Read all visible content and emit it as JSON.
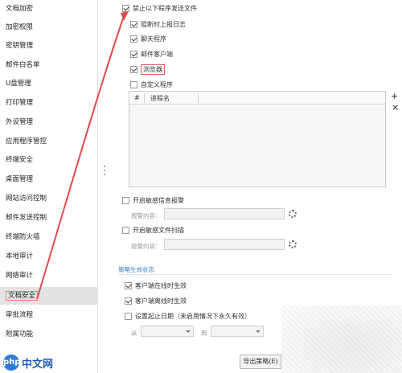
{
  "sidebar": {
    "items": [
      {
        "label": "文档加密"
      },
      {
        "label": "加密权限"
      },
      {
        "label": "密钥管理"
      },
      {
        "label": "邮件白名单"
      },
      {
        "label": "U盘管理"
      },
      {
        "label": "打印管理"
      },
      {
        "label": "外设管理"
      },
      {
        "label": "应用程序管控"
      },
      {
        "label": "终端安全"
      },
      {
        "label": "桌面管理"
      },
      {
        "label": "网站访问控制"
      },
      {
        "label": "邮件发送控制"
      },
      {
        "label": "终端防火墙"
      },
      {
        "label": "本地审计"
      },
      {
        "label": "网络审计"
      },
      {
        "label": "文档安全",
        "active": true
      },
      {
        "label": "审批流程"
      },
      {
        "label": "附属功能"
      }
    ]
  },
  "main": {
    "forbid_send": "禁止以下程序发送文件",
    "report_log": "阻断时上报日志",
    "chat": "聊天程序",
    "mail_client": "邮件客户端",
    "browser": "浏览器",
    "custom": "自定义程序",
    "list_col_num": "#",
    "list_col_name": "进程名",
    "add_symbol": "+",
    "remove_symbol": "×",
    "keyword_alarm": "开启敏感信息报警",
    "alarm_content_label": "报警内容：",
    "sensitive_scan": "开启敏感文件扫描",
    "scan_content_label": "报警内容：",
    "policy_section": "策略生效状态",
    "effective_online": "客户端在线时生效",
    "effective_offline": "客户端离线时生效",
    "set_dates": "设置起止日期（未启用情况下永久有效）",
    "from_label": "从",
    "to_label": "到",
    "export_button": "导出策略(E)"
  },
  "watermark": {
    "badge": "php",
    "text": "中文网"
  },
  "colors": {
    "accent": "#3a7fc0",
    "highlight": "#e45a5a",
    "active_bg": "#e2e2e2"
  }
}
